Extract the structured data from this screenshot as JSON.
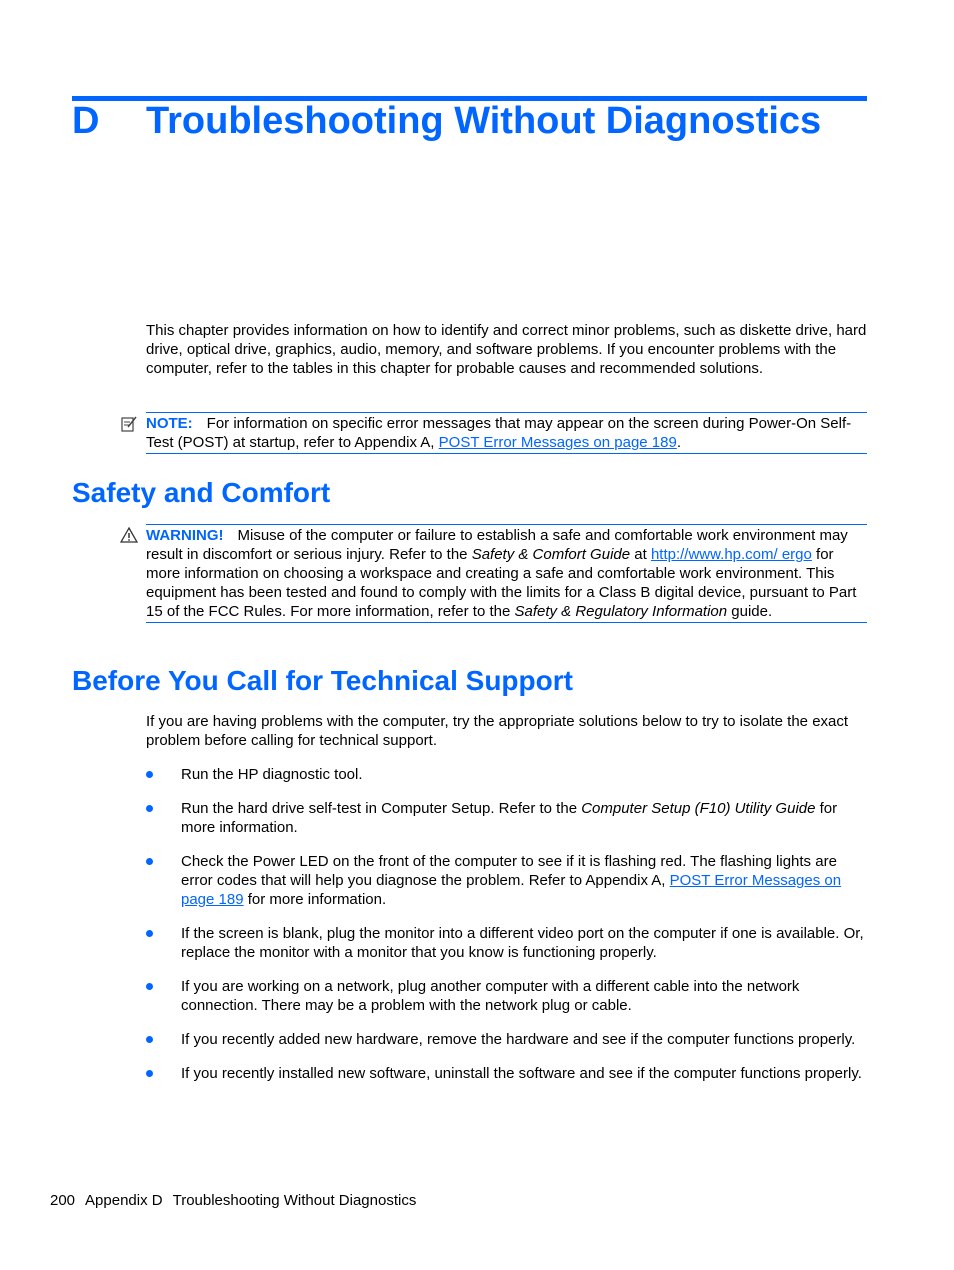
{
  "chapter": {
    "letter": "D",
    "title": "Troubleshooting Without Diagnostics",
    "intro": "This chapter provides information on how to identify and correct minor problems, such as diskette drive, hard drive, optical drive, graphics, audio, memory, and software problems. If you encounter problems with the computer, refer to the tables in this chapter for probable causes and recommended solutions."
  },
  "note": {
    "icon": "note-pencil-icon",
    "label": "NOTE:",
    "text": "For information on specific error messages that may appear on the screen during Power-On Self-Test (POST) at startup, refer to Appendix A, ",
    "link": "POST Error Messages on page 189",
    "after": "."
  },
  "safety": {
    "heading": "Safety and Comfort",
    "warning_icon": "warning-triangle-icon",
    "warning_label": "WARNING!",
    "text1": "Misuse of the computer or failure to establish a safe and comfortable work environment may result in discomfort or serious injury. Refer to the ",
    "italic1": "Safety & Comfort Guide",
    "text2": " at ",
    "link": "http://www.hp.com/ ergo",
    "text3": " for more information on choosing a workspace and creating a safe and comfortable work environment. This equipment has been tested and found to comply with the limits for a Class B digital device, pursuant to Part 15 of the FCC Rules. For more information, refer to the ",
    "italic2": "Safety & Regulatory Information",
    "text4": " guide."
  },
  "support": {
    "heading": "Before You Call for Technical Support",
    "intro": "If you are having problems with the computer, try the appropriate solutions below to try to isolate the exact problem before calling for technical support.",
    "bullets": [
      {
        "text": "Run the HP diagnostic tool."
      },
      {
        "text": "Run the hard drive self-test in Computer Setup. Refer to the ",
        "italic": "Computer Setup (F10) Utility Guide",
        "after": " for more information."
      },
      {
        "text": "Check the Power LED on the front of the computer to see if it is flashing red. The flashing lights are error codes that will help you diagnose the problem. Refer to Appendix A, ",
        "link": "POST Error Messages on page 189",
        "after": " for more information."
      },
      {
        "text": "If the screen is blank, plug the monitor into a different video port on the computer if one is available. Or, replace the monitor with a monitor that you know is functioning properly."
      },
      {
        "text": "If you are working on a network, plug another computer with a different cable into the network connection. There may be a problem with the network plug or cable."
      },
      {
        "text": "If you recently added new hardware, remove the hardware and see if the computer functions properly."
      },
      {
        "text": "If you recently installed new software, uninstall the software and see if the computer functions properly."
      }
    ]
  },
  "footer": {
    "page": "200",
    "section": "Appendix D",
    "title": "Troubleshooting Without Diagnostics"
  }
}
